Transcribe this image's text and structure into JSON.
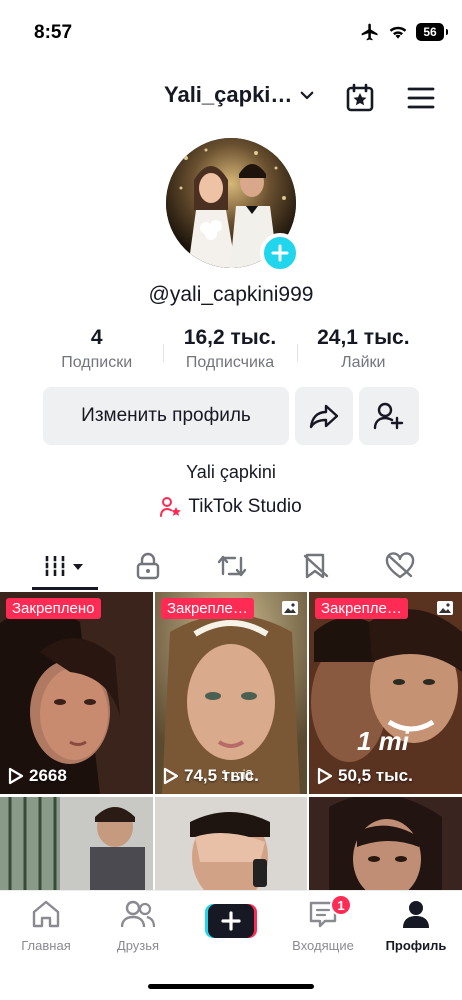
{
  "status_bar": {
    "time": "8:57",
    "battery": "56"
  },
  "header": {
    "username": "Yali_çapki…"
  },
  "profile": {
    "handle": "@yali_capkini999",
    "stats": [
      {
        "value": "4",
        "label": "Подписки"
      },
      {
        "value": "16,2 тыс.",
        "label": "Подписчика"
      },
      {
        "value": "24,1 тыс.",
        "label": "Лайки"
      }
    ],
    "edit_label": "Изменить профиль",
    "bio": "Yali çapkini",
    "studio_label": "TikTok Studio"
  },
  "tabs": [
    {
      "icon": "grid-icon"
    },
    {
      "icon": "lock-icon"
    },
    {
      "icon": "repost-icon"
    },
    {
      "icon": "favorites-icon"
    },
    {
      "icon": "liked-icon"
    }
  ],
  "videos": [
    {
      "pinned": "Закреплено",
      "views": "2668",
      "photo": false
    },
    {
      "pinned": "Закрепле…",
      "views": "74,5 тыс.",
      "photo": true,
      "overlay": "1 mi3"
    },
    {
      "pinned": "Закрепле…",
      "views": "50,5 тыс.",
      "photo": true,
      "overlay": "1 mi"
    },
    {
      "pinned": "",
      "views": "",
      "photo": false
    },
    {
      "pinned": "",
      "views": "",
      "photo": false
    },
    {
      "pinned": "",
      "views": "",
      "photo": false
    }
  ],
  "bottom_nav": [
    {
      "label": "Главная",
      "icon": "home-icon"
    },
    {
      "label": "Друзья",
      "icon": "friends-icon"
    },
    {
      "label": "",
      "icon": "create-icon"
    },
    {
      "label": "Входящие",
      "icon": "inbox-icon",
      "badge": "1"
    },
    {
      "label": "Профиль",
      "icon": "profile-icon",
      "active": true
    }
  ],
  "colors": {
    "accent": "#fe2c55",
    "teal": "#20d5ec",
    "text": "#161823",
    "muted": "#73757c"
  }
}
